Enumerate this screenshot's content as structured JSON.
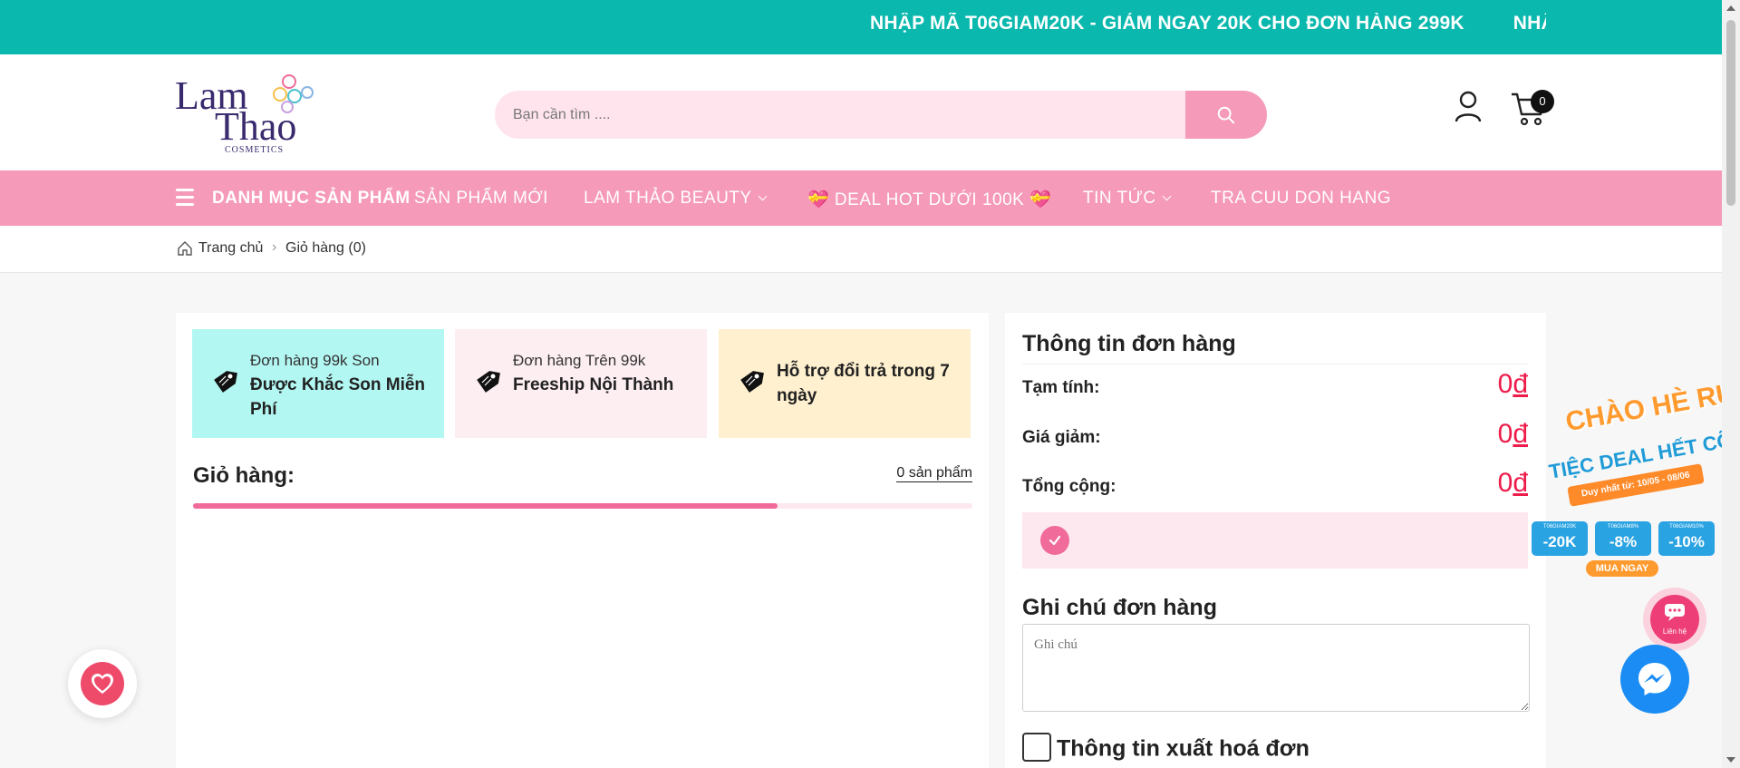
{
  "announcement": {
    "messages": [
      "NHẬP MÃ T06GIAM20K - GIẢM NGAY 20K CHO ĐƠN HÀNG 299K",
      "NHẬP M"
    ]
  },
  "header": {
    "logo": {
      "line1": "Lam",
      "line2": "Thao",
      "line3": "COSMETICS"
    },
    "search": {
      "placeholder": "Bạn cần tìm ...."
    },
    "cart_count": "0"
  },
  "nav": {
    "items": [
      {
        "label": "DANH MỤC SẢN PHẨM"
      },
      {
        "label": "SẢN PHẨM MỚI"
      },
      {
        "label": "LAM THẢO BEAUTY"
      },
      {
        "label": "💝 DEAL HOT DƯỚI 100K 💝"
      },
      {
        "label": "TIN TỨC"
      },
      {
        "label": "TRA CUU DON HANG"
      }
    ]
  },
  "breadcrumb": {
    "home": "Trang chủ",
    "current": "Giỏ hàng (0)"
  },
  "perks": [
    {
      "line1": "Đơn hàng 99k Son",
      "line2": "Được Khắc Son Miễn Phí",
      "bg": "#b3f7f3"
    },
    {
      "line1": "Đơn hàng Trên 99k",
      "line2": "Freeship Nội Thành",
      "bg": "#fdeef2"
    },
    {
      "line1": "",
      "line2": "Hỗ trợ đổi trả trong 7 ngày",
      "bg": "#fff0cf"
    }
  ],
  "cart": {
    "title": "Giỏ hàng:",
    "count_label": "0 sản phẩm",
    "progress": 0.75
  },
  "order": {
    "title": "Thông tin đơn hàng",
    "subtotal_label": "Tạm tính:",
    "subtotal": "0",
    "discount_label": "Giá giảm:",
    "discount": "0",
    "total_label": "Tổng cộng:",
    "total": "0",
    "currency": "đ",
    "note_title": "Ghi chú đơn hàng",
    "note_placeholder": "Ghi chú",
    "invoice_label": "Thông tin xuất hoá đơn"
  },
  "promo": {
    "line1": "CHÀO HÈ RỰC RỠ",
    "line2": "TIỆC DEAL HẾT CỠ",
    "dates": "Duy nhất từ: 10/05 - 08/06",
    "coupons": [
      {
        "code": "T06GIAM20K",
        "value": "-20K"
      },
      {
        "code": "T06GIAM8%",
        "value": "-8%"
      },
      {
        "code": "T06GIAM10%",
        "value": "-10%"
      }
    ],
    "cta": "MUA NGAY"
  },
  "contact_label": "Liên hệ",
  "colors": {
    "teal": "#0ab8ad",
    "pink": "#f59ab8",
    "price": "#ee1c4a"
  }
}
